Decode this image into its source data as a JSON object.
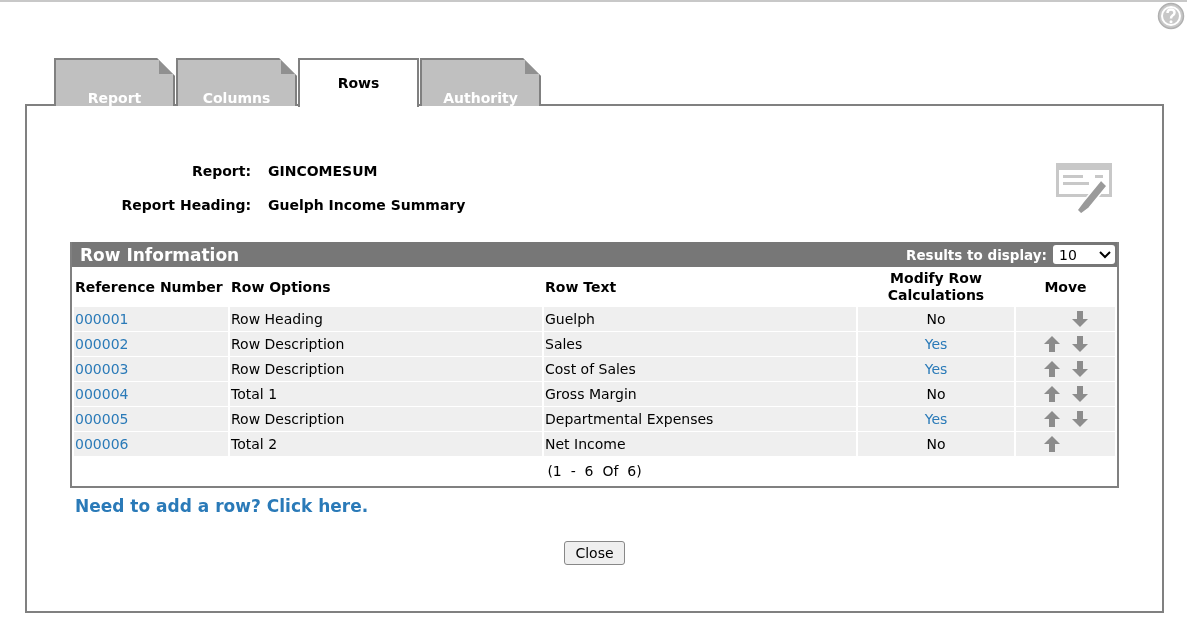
{
  "tabs": [
    {
      "label": "Report",
      "selected": false
    },
    {
      "label": "Columns",
      "selected": false
    },
    {
      "label": "Rows",
      "selected": true
    },
    {
      "label": "Authority",
      "selected": false
    }
  ],
  "fields": [
    {
      "label": "Report:",
      "value": "GINCOMESUM"
    },
    {
      "label": "Report Heading:",
      "value": "Guelph Income Summary"
    }
  ],
  "table": {
    "title": "Row Information",
    "results_label": "Results to display:",
    "results_value": "10",
    "columns": [
      "Reference Number",
      "Row Options",
      "Row Text",
      "Modify Row Calculations",
      "Move"
    ],
    "rows": [
      {
        "reference": "000001",
        "option": "Row Heading",
        "text": "Guelph",
        "modify": "No",
        "modify_link": false,
        "move_up": false,
        "move_down": true
      },
      {
        "reference": "000002",
        "option": "Row Description",
        "text": "Sales",
        "modify": "Yes",
        "modify_link": true,
        "move_up": true,
        "move_down": true
      },
      {
        "reference": "000003",
        "option": "Row Description",
        "text": "Cost of Sales",
        "modify": "Yes",
        "modify_link": true,
        "move_up": true,
        "move_down": true
      },
      {
        "reference": "000004",
        "option": "Total 1",
        "text": "Gross Margin",
        "modify": "No",
        "modify_link": false,
        "move_up": true,
        "move_down": true
      },
      {
        "reference": "000005",
        "option": "Row Description",
        "text": "Departmental Expenses",
        "modify": "Yes",
        "modify_link": true,
        "move_up": true,
        "move_down": true
      },
      {
        "reference": "000006",
        "option": "Total 2",
        "text": "Net Income",
        "modify": "No",
        "modify_link": false,
        "move_up": true,
        "move_down": false
      }
    ],
    "pagination": "(1  -  6  Of  6)"
  },
  "add_link": "Need to add a row? Click here.",
  "close_button": "Close"
}
